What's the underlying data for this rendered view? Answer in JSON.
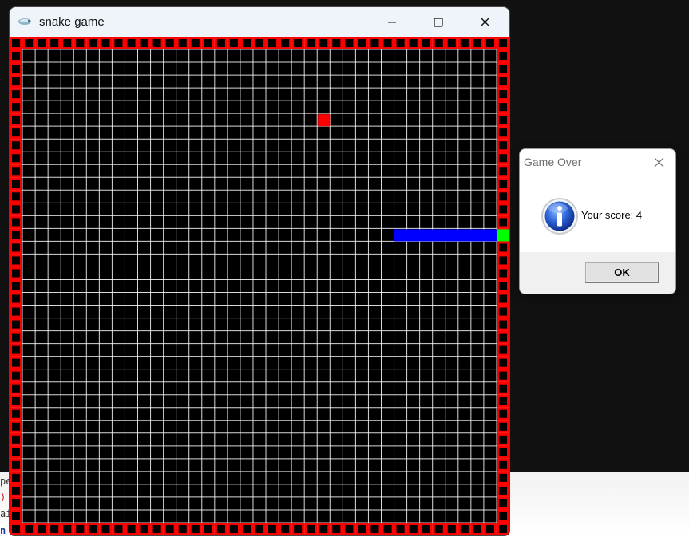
{
  "background_editor": {
    "lines": [
      {
        "text": "pe",
        "color": "#333333"
      },
      {
        "text": ") ",
        "color": "#cc2222"
      },
      {
        "text": "ai",
        "color": "#333333"
      },
      {
        "text": "n",
        "color": "#1f3aa8"
      }
    ]
  },
  "game_window": {
    "title": "snake game",
    "icon": "python-snake-icon",
    "controls": {
      "minimize": "minimize-icon",
      "maximize": "maximize-icon",
      "close": "close-icon"
    }
  },
  "board": {
    "columns": 39,
    "rows": 39,
    "colors": {
      "background": "#000000",
      "grid": "#ffffff",
      "wall": "#ff0000",
      "food": "#ff0000",
      "snake_body": "#0000ff",
      "snake_head": "#00ff00"
    },
    "food": {
      "col": 24,
      "row": 6
    },
    "snake": {
      "head": {
        "col": 38,
        "row": 15
      },
      "body": [
        {
          "col": 30,
          "row": 15
        },
        {
          "col": 31,
          "row": 15
        },
        {
          "col": 32,
          "row": 15
        },
        {
          "col": 33,
          "row": 15
        },
        {
          "col": 34,
          "row": 15
        },
        {
          "col": 35,
          "row": 15
        },
        {
          "col": 36,
          "row": 15
        },
        {
          "col": 37,
          "row": 15
        }
      ]
    }
  },
  "dialog": {
    "title": "Game Over",
    "message": "Your score: 4",
    "icon": "information-icon",
    "ok_label": "OK"
  }
}
